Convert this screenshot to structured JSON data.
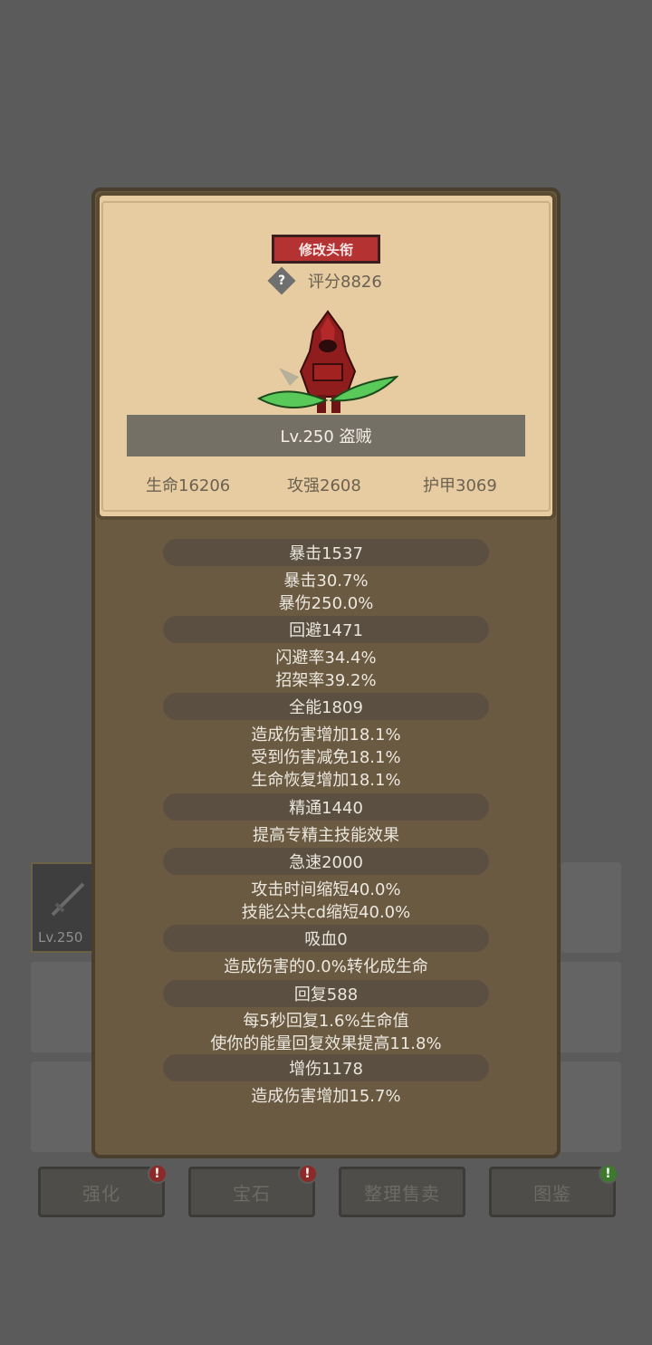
{
  "header": {
    "modify_title_button": "修改头衔",
    "score_label": "评分8826"
  },
  "hero": {
    "level_name": "Lv.250 盗贼",
    "stats": [
      "生命16206",
      "攻强2608",
      "护甲3069"
    ]
  },
  "attributes": [
    {
      "title": "暴击1537",
      "lines": [
        "暴击30.7%",
        "暴伤250.0%"
      ]
    },
    {
      "title": "回避1471",
      "lines": [
        "闪避率34.4%",
        "招架率39.2%"
      ]
    },
    {
      "title": "全能1809",
      "lines": [
        "造成伤害增加18.1%",
        "受到伤害减免18.1%",
        "生命恢复增加18.1%"
      ]
    },
    {
      "title": "精通1440",
      "lines": [
        "提高专精主技能效果"
      ]
    },
    {
      "title": "急速2000",
      "lines": [
        "攻击时间缩短40.0%",
        "技能公共cd缩短40.0%"
      ]
    },
    {
      "title": "吸血0",
      "lines": [
        "造成伤害的0.0%转化成生命"
      ]
    },
    {
      "title": "回复588",
      "lines": [
        "每5秒回复1.6%生命值",
        "使你的能量回复效果提高11.8%"
      ]
    },
    {
      "title": "增伤1178",
      "lines": [
        "造成伤害增加15.7%"
      ]
    }
  ],
  "background": {
    "item_level": "Lv.250",
    "bottom_buttons": [
      {
        "label": "强化",
        "badge": "!",
        "badge_color": "#8c2a2a"
      },
      {
        "label": "宝石",
        "badge": "!",
        "badge_color": "#8c2a2a"
      },
      {
        "label": "整理售卖",
        "badge": "",
        "badge_color": ""
      },
      {
        "label": "图鉴",
        "badge": "!",
        "badge_color": "#3d7a2e"
      }
    ]
  }
}
